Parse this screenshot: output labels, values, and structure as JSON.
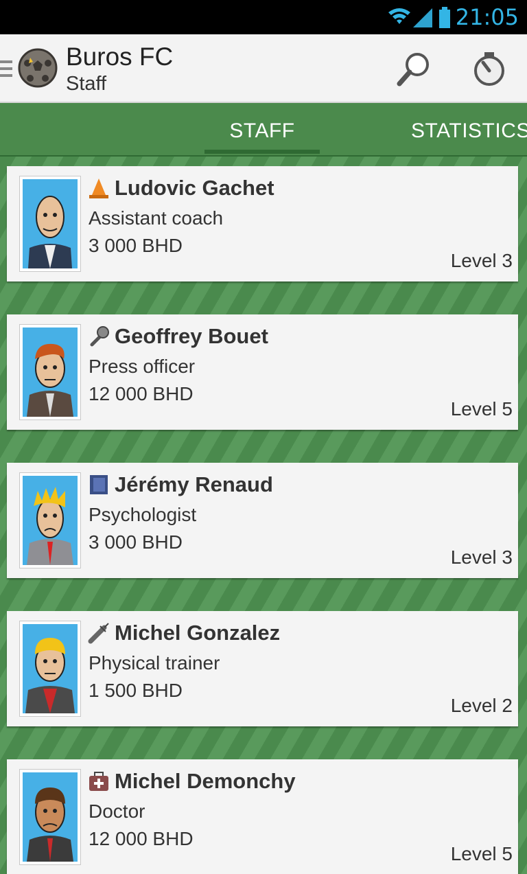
{
  "status_bar": {
    "time": "21:05",
    "icons": [
      "wifi-icon",
      "signal-icon",
      "battery-icon"
    ],
    "time_color": "#33b5e5"
  },
  "action_bar": {
    "title": "Buros FC",
    "subtitle": "Staff",
    "icons": [
      "drawer-icon",
      "club-logo",
      "search-icon",
      "timer-icon"
    ]
  },
  "tabs": [
    {
      "label": "STAFF",
      "selected": true
    },
    {
      "label": "STATISTICS",
      "selected": false
    }
  ],
  "colors": {
    "tab_bar": "#4b8a4c",
    "stripe_dark": "#4a8a4d",
    "stripe_light": "#599a5c",
    "card": "#f4f4f4"
  },
  "staff": [
    {
      "name": "Ludovic Gachet",
      "role": "Assistant coach",
      "salary": "3 000 BHD",
      "level": "Level 3",
      "role_icon": "cone-icon"
    },
    {
      "name": "Geoffrey Bouet",
      "role": "Press officer",
      "salary": "12 000 BHD",
      "level": "Level 5",
      "role_icon": "microphone-icon"
    },
    {
      "name": "Jérémy Renaud",
      "role": "Psychologist",
      "salary": "3 000 BHD",
      "level": "Level 3",
      "role_icon": "book-icon"
    },
    {
      "name": "Michel Gonzalez",
      "role": "Physical trainer",
      "salary": "1 500 BHD",
      "level": "Level 2",
      "role_icon": "syringe-icon"
    },
    {
      "name": "Michel Demonchy",
      "role": "Doctor",
      "salary": "12 000 BHD",
      "level": "Level 5",
      "role_icon": "medical-bag-icon"
    }
  ]
}
